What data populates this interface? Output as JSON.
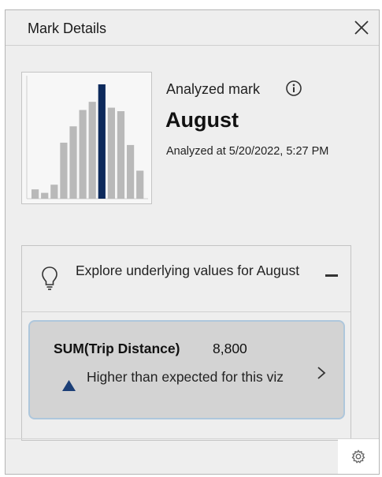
{
  "panel": {
    "title": "Mark Details",
    "close_icon": "close-icon"
  },
  "analysis": {
    "label": "Analyzed mark",
    "info_icon": "info-icon",
    "mark": "August",
    "analyzed_at": "Analyzed at 5/20/2022, 5:27 PM"
  },
  "thumbnail_chart": {
    "bar_heights": [
      0.08,
      0.05,
      0.12,
      0.48,
      0.62,
      0.76,
      0.83,
      0.98,
      0.78,
      0.75,
      0.46,
      0.24
    ],
    "highlighted_index": 7,
    "bar_color": "#b9b9b9",
    "highlight_color": "#0d2a5c"
  },
  "explore": {
    "text": "Explore underlying values for August",
    "bulb_icon": "lightbulb-icon",
    "collapse_icon": "minus-icon"
  },
  "metric": {
    "name": "SUM(Trip Distance)",
    "value": "8,800",
    "description": "Higher than expected for this viz",
    "trend_icon": "triangle-up-icon",
    "trend_color": "#1c3f77",
    "chevron_icon": "chevron-right-icon"
  },
  "footer": {
    "settings_icon": "gear-icon"
  }
}
